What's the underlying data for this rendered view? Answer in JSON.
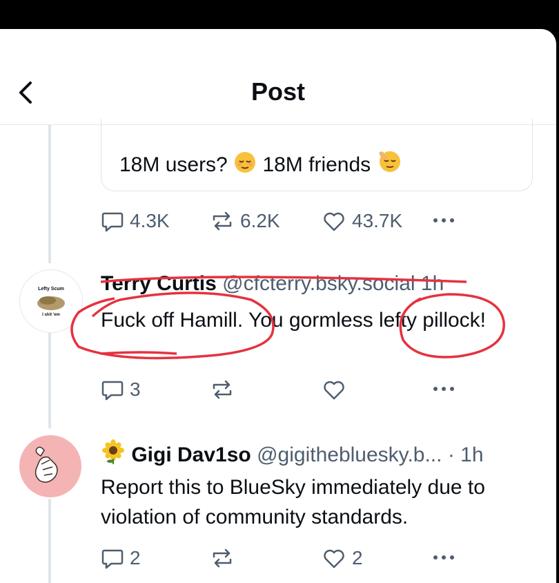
{
  "header": {
    "title": "Post"
  },
  "quoted": {
    "text_before": "18M users?",
    "text_after": "18M friends"
  },
  "main_post_actions": {
    "replies": "4.3K",
    "reposts": "6.2K",
    "likes": "43.7K"
  },
  "posts": [
    {
      "avatar_caption_top": "Lefty Scum",
      "avatar_caption_bottom": "I shit 'em",
      "name": "Terry Curtis",
      "handle": "@cfcterry.bsky.social",
      "time": "1h",
      "text": "Fuck off Hamill. You gormless lefty pillock!",
      "replies": "3",
      "reposts": "",
      "likes": ""
    },
    {
      "name": "Gigi Dav1so",
      "handle": "@gigithebluesky.b...",
      "time": "· 1h",
      "text": "Report this to BlueSky immediately due to violation of community standards.",
      "replies": "2",
      "reposts": "",
      "likes": "2"
    }
  ],
  "colors": {
    "accent": "#e5323f",
    "muted": "#4e5d6e",
    "border": "#dfe5eb"
  }
}
